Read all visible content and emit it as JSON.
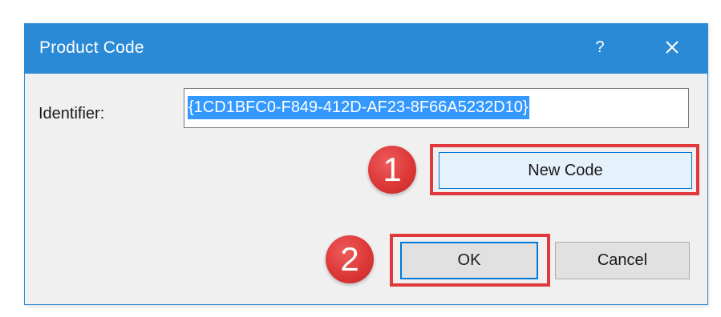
{
  "dialog": {
    "title": "Product Code",
    "help_label": "?"
  },
  "form": {
    "identifier_label": "Identifier:",
    "identifier_value": "{1CD1BFC0-F849-412D-AF23-8F66A5232D10}"
  },
  "buttons": {
    "new_code": "New Code",
    "ok": "OK",
    "cancel": "Cancel"
  },
  "annotations": {
    "step1": "1",
    "step2": "2"
  },
  "colors": {
    "accent": "#2b8ad6",
    "focus": "#0078d7",
    "selection": "#3399ff",
    "annotation": "#e0393e"
  },
  "icons": {
    "close": "close-icon"
  }
}
